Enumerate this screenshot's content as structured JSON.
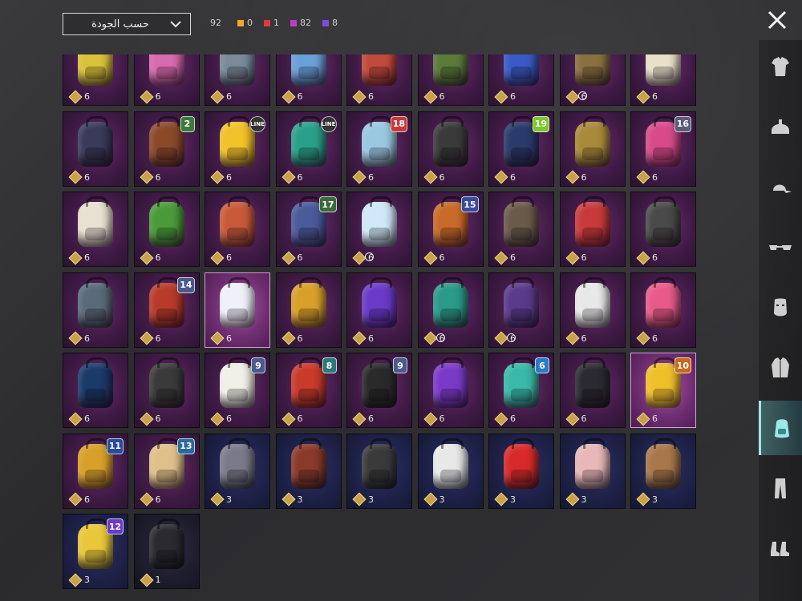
{
  "sort": {
    "label": "حسب الجودة"
  },
  "counters": {
    "total": "92",
    "items": [
      {
        "color": "#f5a623",
        "value": "0"
      },
      {
        "color": "#e53935",
        "value": "1"
      },
      {
        "color": "#c03cc8",
        "value": "82"
      },
      {
        "color": "#7a4ce0",
        "value": "8"
      }
    ]
  },
  "sidebar": {
    "items": [
      {
        "name": "outfit-category",
        "icon": "shirt-icon"
      },
      {
        "name": "helmet-category",
        "icon": "helmet-icon"
      },
      {
        "name": "hat-category",
        "icon": "cap-icon"
      },
      {
        "name": "glasses-category",
        "icon": "glasses-icon"
      },
      {
        "name": "mask-category",
        "icon": "mask-icon"
      },
      {
        "name": "jacket-category",
        "icon": "jacket-icon"
      },
      {
        "name": "backpack-category",
        "icon": "backpack-icon",
        "active": true
      },
      {
        "name": "pants-category",
        "icon": "pants-icon"
      },
      {
        "name": "shoes-category",
        "icon": "shoes-icon"
      }
    ]
  },
  "items": [
    {
      "q": "p",
      "c": "#d9c23a",
      "n": "6"
    },
    {
      "q": "p",
      "c": "#d86ab0",
      "n": "6"
    },
    {
      "q": "p",
      "c": "#7a8a9a",
      "n": "6"
    },
    {
      "q": "p",
      "c": "#6aa0d8",
      "n": "6"
    },
    {
      "q": "p",
      "c": "#c24a3a",
      "n": "6"
    },
    {
      "q": "p",
      "c": "#5a7a3a",
      "n": "6"
    },
    {
      "q": "p",
      "c": "#3a5ac8",
      "n": "6"
    },
    {
      "q": "p",
      "c": "#8a7040",
      "n": "6",
      "round": true
    },
    {
      "q": "p",
      "c": "#e8e0c8",
      "n": "6"
    },
    {
      "q": "p",
      "c": "#3a3a5a",
      "n": "6"
    },
    {
      "q": "p",
      "c": "#8a4a2a",
      "n": "6",
      "lv": "2",
      "lc": "#3a7a3a"
    },
    {
      "q": "p",
      "c": "#f2c22a",
      "n": "6",
      "lv": "LINE",
      "lc": "#333"
    },
    {
      "q": "p",
      "c": "#2aa08a",
      "n": "6",
      "lv": "LINE",
      "lc": "#333"
    },
    {
      "q": "p",
      "c": "#9ac8e0",
      "n": "6",
      "lv": "18",
      "lc": "#c83a3a"
    },
    {
      "q": "p",
      "c": "#3a3a3a",
      "n": "6"
    },
    {
      "q": "p",
      "c": "#2a3a6a",
      "n": "6",
      "lv": "19",
      "lc": "#7ac82a"
    },
    {
      "q": "p",
      "c": "#a88a3a",
      "n": "6"
    },
    {
      "q": "p",
      "c": "#d84a8a",
      "n": "6",
      "lv": "16",
      "lc": "#5a5a7a"
    },
    {
      "q": "p",
      "c": "#e8e0d0",
      "n": "6"
    },
    {
      "q": "p",
      "c": "#4a9a3a",
      "n": "6"
    },
    {
      "q": "p",
      "c": "#c85a3a",
      "n": "6"
    },
    {
      "q": "p",
      "c": "#4a5a9a",
      "n": "6",
      "lv": "17",
      "lc": "#3a6a3a"
    },
    {
      "q": "p",
      "c": "#d0e8f8",
      "n": "6",
      "round": true
    },
    {
      "q": "p",
      "c": "#c86a2a",
      "n": "6",
      "lv": "15",
      "lc": "#3a4a9a"
    },
    {
      "q": "p",
      "c": "#6a5a4a",
      "n": "6"
    },
    {
      "q": "p",
      "c": "#c83a3a",
      "n": "6"
    },
    {
      "q": "p",
      "c": "#4a4a4a",
      "n": "6"
    },
    {
      "q": "p",
      "c": "#5a6a7a",
      "n": "6"
    },
    {
      "q": "p",
      "c": "#b83a2a",
      "n": "6",
      "lv": "14",
      "lc": "#4a5a8a"
    },
    {
      "q": "sel",
      "c": "#f0f0f8",
      "n": "6"
    },
    {
      "q": "p",
      "c": "#d8a02a",
      "n": "6"
    },
    {
      "q": "p",
      "c": "#6a3ac8",
      "n": "6"
    },
    {
      "q": "p",
      "c": "#2a9a8a",
      "n": "6",
      "round": true
    },
    {
      "q": "p",
      "c": "#5a3a8a",
      "n": "6",
      "round": true
    },
    {
      "q": "p",
      "c": "#e8e8e8",
      "n": "6"
    },
    {
      "q": "p",
      "c": "#e85a8a",
      "n": "6"
    },
    {
      "q": "p",
      "c": "#1a3a6a",
      "n": "6"
    },
    {
      "q": "p",
      "c": "#3a3a3a",
      "n": "6"
    },
    {
      "q": "p",
      "c": "#f0f0e8",
      "n": "6",
      "lv": "9",
      "lc": "#4a5a8a"
    },
    {
      "q": "p",
      "c": "#c83a2a",
      "n": "6",
      "lv": "8",
      "lc": "#2a7a7a"
    },
    {
      "q": "p",
      "c": "#2a2a2a",
      "n": "6",
      "lv": "9",
      "lc": "#4a5a8a"
    },
    {
      "q": "p",
      "c": "#7a3ac8",
      "n": "6"
    },
    {
      "q": "p",
      "c": "#3ab8a8",
      "n": "6",
      "lv": "6",
      "lc": "#2a7ac8"
    },
    {
      "q": "p",
      "c": "#2a2a30",
      "n": "6"
    },
    {
      "q": "sel",
      "c": "#f0c02a",
      "n": "6",
      "lv": "10",
      "lc": "#c86a1a"
    },
    {
      "q": "p",
      "c": "#d8a02a",
      "n": "6",
      "lv": "11",
      "lc": "#2a4a9a"
    },
    {
      "q": "p",
      "c": "#e0c08a",
      "n": "6",
      "lv": "13",
      "lc": "#2a6a9a"
    },
    {
      "q": "b",
      "c": "#7a7a8a",
      "n": "3"
    },
    {
      "q": "b",
      "c": "#8a3a2a",
      "n": "3"
    },
    {
      "q": "b",
      "c": "#3a3a3a",
      "n": "3"
    },
    {
      "q": "b",
      "c": "#e8e8e8",
      "n": "3"
    },
    {
      "q": "b",
      "c": "#d82a2a",
      "n": "3"
    },
    {
      "q": "b",
      "c": "#e8b8b8",
      "n": "3"
    },
    {
      "q": "b",
      "c": "#a8784a",
      "n": "3"
    },
    {
      "q": "b",
      "c": "#e8c83a",
      "n": "3",
      "lv": "12",
      "lc": "#6a3ac8"
    },
    {
      "q": "d",
      "c": "#2a2a30",
      "n": "1"
    }
  ]
}
